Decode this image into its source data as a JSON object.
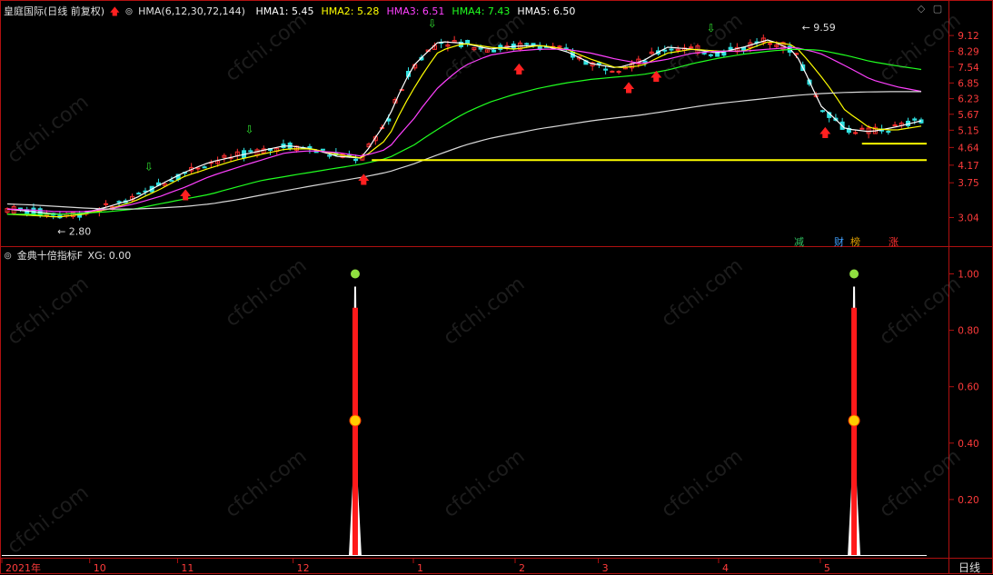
{
  "header_top": {
    "title": "皇庭国际(日线 前复权)",
    "indicator": "HMA(6,12,30,72,144)",
    "items": [
      {
        "label": "HMA1: 5.45",
        "color": "#ffffff"
      },
      {
        "label": "HMA2: 5.28",
        "color": "#ffff00"
      },
      {
        "label": "HMA3: 6.51",
        "color": "#ff40ff"
      },
      {
        "label": "HMA4: 7.43",
        "color": "#20ff20"
      },
      {
        "label": "HMA5: 6.50",
        "color": "#ffffff"
      }
    ]
  },
  "header_bottom": {
    "title": "金典十倍指标F",
    "value": "XG: 0.00"
  },
  "badges": [
    {
      "label": "减",
      "color": "#30c060"
    },
    {
      "label": "财",
      "color": "#40a0ff"
    },
    {
      "label": "榜",
      "color": "#e0a000"
    },
    {
      "label": "涨",
      "color": "#ff3030"
    }
  ],
  "period_label": "日线",
  "watermark": "cfchi.com",
  "chart_data": [
    {
      "type": "line",
      "panel": "price",
      "y_ticks": [
        9.12,
        8.29,
        7.54,
        6.85,
        6.23,
        5.67,
        5.15,
        4.64,
        4.17,
        3.75,
        3.04
      ],
      "annotations": [
        {
          "text": "9.59"
        },
        {
          "text": "2.80"
        }
      ],
      "x_labels": [
        "2021年",
        "10",
        "11",
        "12",
        "1",
        "2",
        "3",
        "4",
        "5"
      ],
      "series": [
        {
          "name": "HMA1",
          "color": "#ffffff",
          "values": [
            3.2,
            3.15,
            3.1,
            3.12,
            3.25,
            3.4,
            3.7,
            4.0,
            4.25,
            4.4,
            4.55,
            4.7,
            4.6,
            4.4,
            4.35,
            5.5,
            7.6,
            8.8,
            8.7,
            8.4,
            8.55,
            8.6,
            8.3,
            7.7,
            7.5,
            7.8,
            8.5,
            8.4,
            8.2,
            8.5,
            8.9,
            8.3,
            6.0,
            5.2,
            5.1,
            5.25,
            5.45
          ]
        },
        {
          "name": "HMA2",
          "color": "#ffff00",
          "values": [
            3.1,
            3.08,
            3.05,
            3.1,
            3.2,
            3.35,
            3.6,
            3.9,
            4.1,
            4.3,
            4.45,
            4.6,
            4.6,
            4.45,
            4.35,
            4.9,
            6.6,
            8.3,
            8.7,
            8.5,
            8.4,
            8.6,
            8.4,
            7.9,
            7.5,
            7.6,
            8.2,
            8.4,
            8.3,
            8.3,
            8.8,
            8.6,
            7.2,
            5.8,
            5.2,
            5.15,
            5.28
          ]
        },
        {
          "name": "HMA3",
          "color": "#ff40ff",
          "values": [
            3.2,
            3.18,
            3.15,
            3.15,
            3.2,
            3.3,
            3.45,
            3.65,
            3.9,
            4.1,
            4.3,
            4.5,
            4.55,
            4.5,
            4.4,
            4.6,
            5.5,
            6.7,
            7.6,
            8.1,
            8.3,
            8.4,
            8.4,
            8.2,
            7.9,
            7.7,
            7.9,
            8.2,
            8.3,
            8.3,
            8.4,
            8.5,
            8.2,
            7.6,
            7.0,
            6.7,
            6.51
          ]
        },
        {
          "name": "HMA4",
          "color": "#20ff20",
          "values": [
            3.1,
            3.1,
            3.1,
            3.12,
            3.15,
            3.2,
            3.3,
            3.4,
            3.5,
            3.65,
            3.8,
            3.9,
            4.0,
            4.1,
            4.2,
            4.35,
            4.7,
            5.2,
            5.7,
            6.1,
            6.4,
            6.65,
            6.85,
            7.0,
            7.1,
            7.2,
            7.4,
            7.7,
            7.95,
            8.15,
            8.3,
            8.4,
            8.35,
            8.1,
            7.8,
            7.6,
            7.43
          ]
        },
        {
          "name": "HMA5",
          "color": "#d8d8d8",
          "values": [
            3.3,
            3.28,
            3.25,
            3.22,
            3.2,
            3.2,
            3.22,
            3.25,
            3.3,
            3.38,
            3.48,
            3.58,
            3.68,
            3.78,
            3.88,
            4.0,
            4.2,
            4.45,
            4.7,
            4.9,
            5.05,
            5.2,
            5.32,
            5.45,
            5.55,
            5.65,
            5.78,
            5.92,
            6.05,
            6.15,
            6.25,
            6.35,
            6.42,
            6.47,
            6.49,
            6.5,
            6.5
          ]
        }
      ],
      "support_lines": [
        4.3,
        4.75
      ]
    },
    {
      "type": "area",
      "panel": "indicator",
      "series_name": "XG",
      "y_ticks": [
        1.0,
        0.8,
        0.6,
        0.4,
        0.2
      ],
      "ylim": [
        0,
        1.05
      ],
      "spikes": [
        {
          "position": 0.374,
          "value": 1.0
        },
        {
          "position": 0.902,
          "value": 1.0
        }
      ]
    }
  ]
}
